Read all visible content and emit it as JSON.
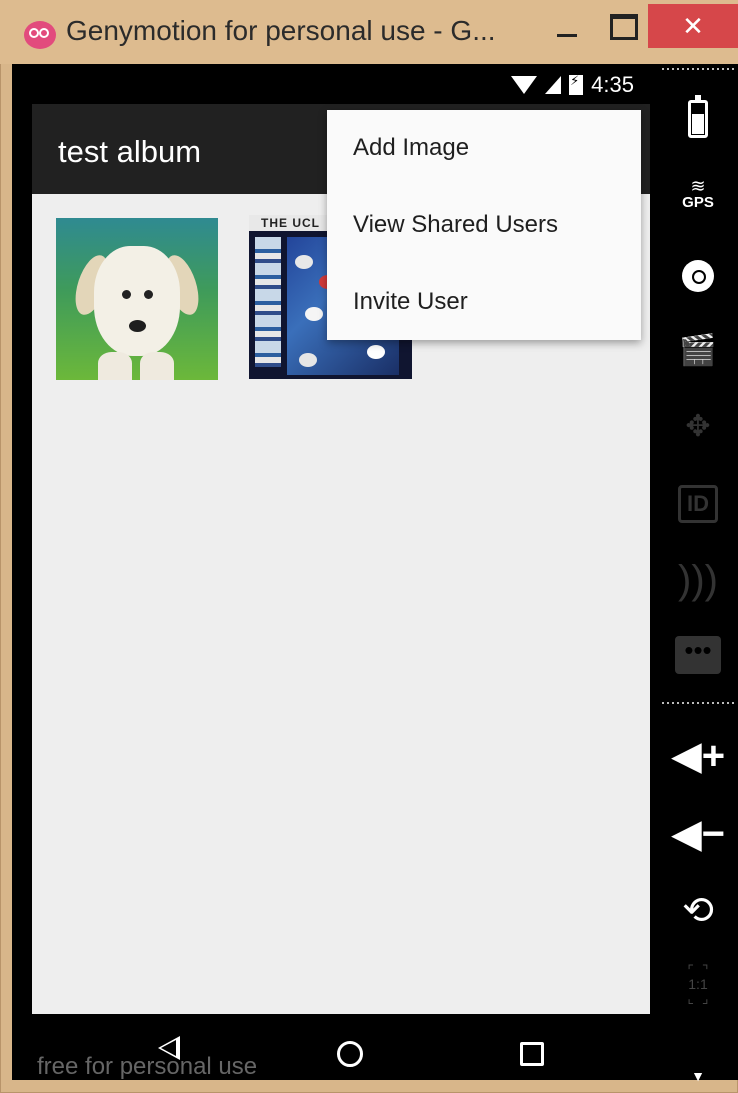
{
  "window": {
    "title": "Genymotion for personal use - G...",
    "close_glyph": "✕"
  },
  "status_bar": {
    "time": "4:35"
  },
  "toolbar": {
    "title": "test album"
  },
  "overflow_menu": {
    "items": [
      {
        "label": "Add Image"
      },
      {
        "label": "View Shared Users"
      },
      {
        "label": "Invite User"
      }
    ]
  },
  "images": [
    {
      "name": "puppy-photo"
    },
    {
      "name": "poster-image",
      "caption_text": "THE UCL"
    }
  ],
  "watermark": "free for personal use",
  "side_toolbar": {
    "gps_label": "GPS",
    "id_label": "ID",
    "chat_glyph": "•••",
    "volume_up": "◀+",
    "volume_down": "◀−",
    "rotate_glyph": "⟲",
    "ratio_label": "1:1"
  },
  "colors": {
    "toolbar_bg": "#212121",
    "screen_bg": "#eeeeee",
    "menu_bg": "#fafafa",
    "window_frame": "#d8b68a",
    "close_button": "#d6474a"
  }
}
